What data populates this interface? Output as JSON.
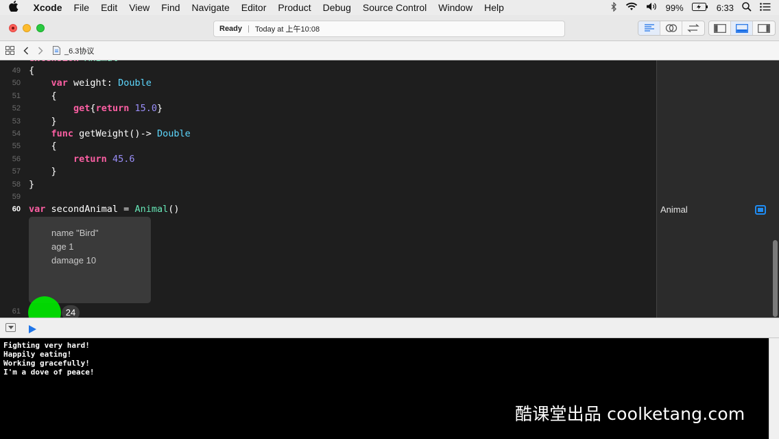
{
  "menubar": {
    "apple": "",
    "items": [
      "Xcode",
      "File",
      "Edit",
      "View",
      "Find",
      "Navigate",
      "Editor",
      "Product",
      "Debug",
      "Source Control",
      "Window",
      "Help"
    ],
    "battery": "99%",
    "time": "6:33"
  },
  "toolbar": {
    "status": "Ready",
    "timestamp": "Today at 上午10:08"
  },
  "jumpbar": {
    "filename": "_6.3协议"
  },
  "editor": {
    "lines": [
      {
        "num": "49",
        "html": "{"
      },
      {
        "num": "50",
        "html": "    <span class='kw'>var</span> weight: <span class='ty'>Double</span>"
      },
      {
        "num": "51",
        "html": "    {"
      },
      {
        "num": "52",
        "html": "        <span class='kw'>get</span>{<span class='kw'>return</span> <span class='num2'>15.0</span>}"
      },
      {
        "num": "53",
        "html": "    }"
      },
      {
        "num": "54",
        "html": "    <span class='kw'>func</span> getWeight()-> <span class='ty'>Double</span>"
      },
      {
        "num": "55",
        "html": "    {"
      },
      {
        "num": "56",
        "html": "        <span class='kw'>return</span> <span class='num2'>45.6</span>"
      },
      {
        "num": "57",
        "html": "    }"
      },
      {
        "num": "58",
        "html": "}"
      },
      {
        "num": "59",
        "html": ""
      },
      {
        "num": "60",
        "html": "<span class='kw'>var</span> secondAnimal = <span class='cl'>Animal</span>()"
      }
    ],
    "last_line_num": "61",
    "tooltip": [
      "name \"Bird\"",
      "age 1",
      "damage 10"
    ],
    "badge": "24"
  },
  "results": {
    "value": "Animal"
  },
  "console": {
    "lines": [
      "Fighting very hard!",
      "Happily eating!",
      "Working gracefully!",
      "I'm a dove of peace!"
    ]
  },
  "watermark": "酷课堂出品 coolketang.com"
}
